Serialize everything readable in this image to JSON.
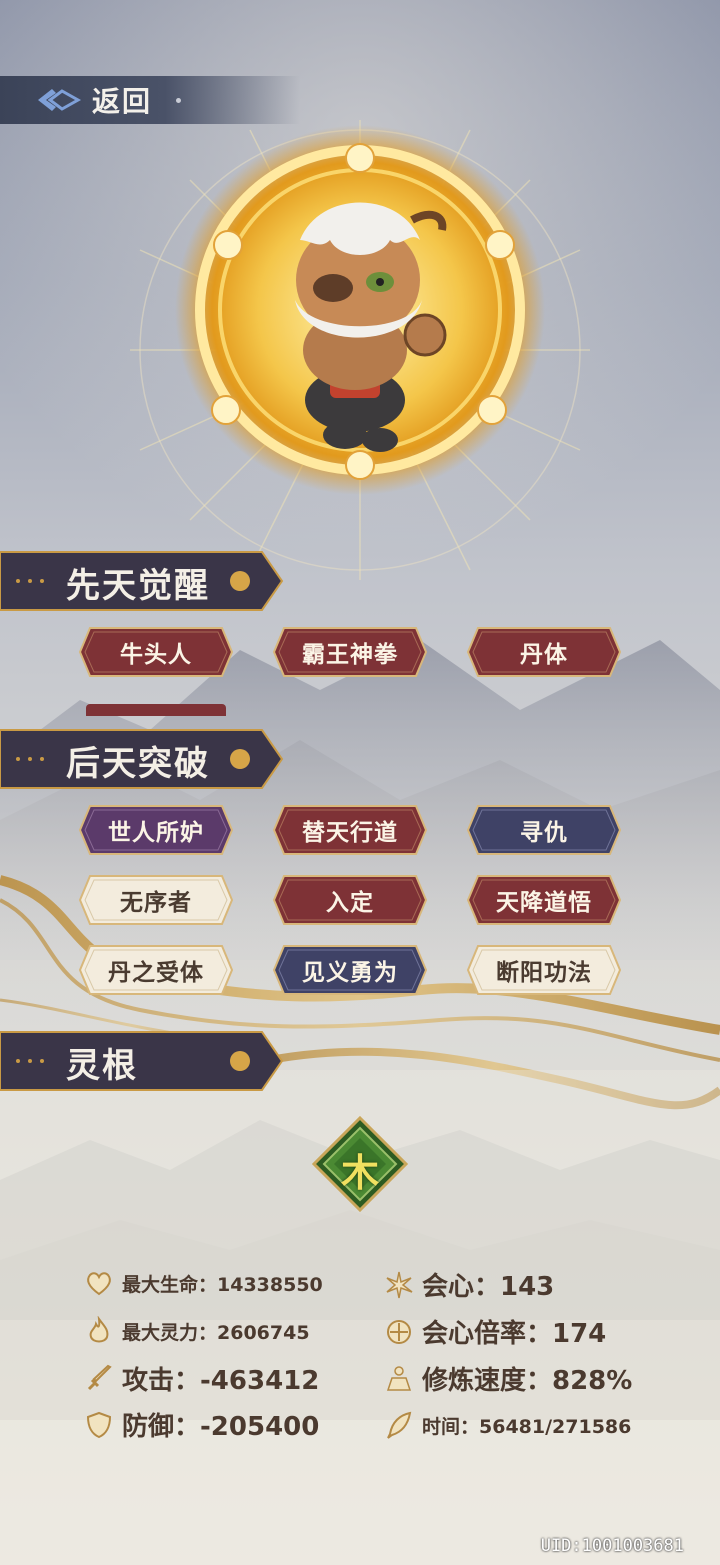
{
  "header": {
    "back_label": "返回"
  },
  "sections": {
    "innate": {
      "title": "先天觉醒",
      "tags": [
        {
          "label": "牛头人",
          "style": "red"
        },
        {
          "label": "霸王神拳",
          "style": "red"
        },
        {
          "label": "丹体",
          "style": "red"
        }
      ]
    },
    "acquired": {
      "title": "后天突破",
      "tags": [
        {
          "label": "世人所妒",
          "style": "purple"
        },
        {
          "label": "替天行道",
          "style": "red"
        },
        {
          "label": "寻仇",
          "style": "blue"
        },
        {
          "label": "无序者",
          "style": "cream"
        },
        {
          "label": "入定",
          "style": "red"
        },
        {
          "label": "天降道悟",
          "style": "red"
        },
        {
          "label": "丹之受体",
          "style": "cream"
        },
        {
          "label": "见义勇为",
          "style": "blue"
        },
        {
          "label": "断阳功法",
          "style": "cream"
        }
      ]
    },
    "spirit_root": {
      "title": "灵根",
      "element": "木"
    }
  },
  "stats": {
    "max_hp": "最大生命：14338550",
    "max_mana": "最大灵力：2606745",
    "attack": "攻击：-463412",
    "defense": "防御：-205400",
    "crit": "会心：143",
    "crit_mult": "会心倍率：174",
    "cultivation_speed": "修炼速度：828%",
    "time": "时间：56481/271586"
  },
  "footer": {
    "uid": "UID:1001003681"
  },
  "colors": {
    "tag_red": "#7e3236",
    "tag_purple": "#5b3a6a",
    "tag_blue": "#3f4266",
    "tag_cream": "#f3ecdd",
    "section_bg": "#3a3548",
    "gold": "#c99a45",
    "element_green": "#3f7a2b"
  },
  "icons": {
    "back": "back-arrow-icon",
    "hp": "heart-icon",
    "mana": "flame-icon",
    "attack": "sword-icon",
    "defense": "shield-icon",
    "crit": "burst-icon",
    "crit_mult": "target-icon",
    "speed": "meditation-icon",
    "time": "feather-icon"
  }
}
